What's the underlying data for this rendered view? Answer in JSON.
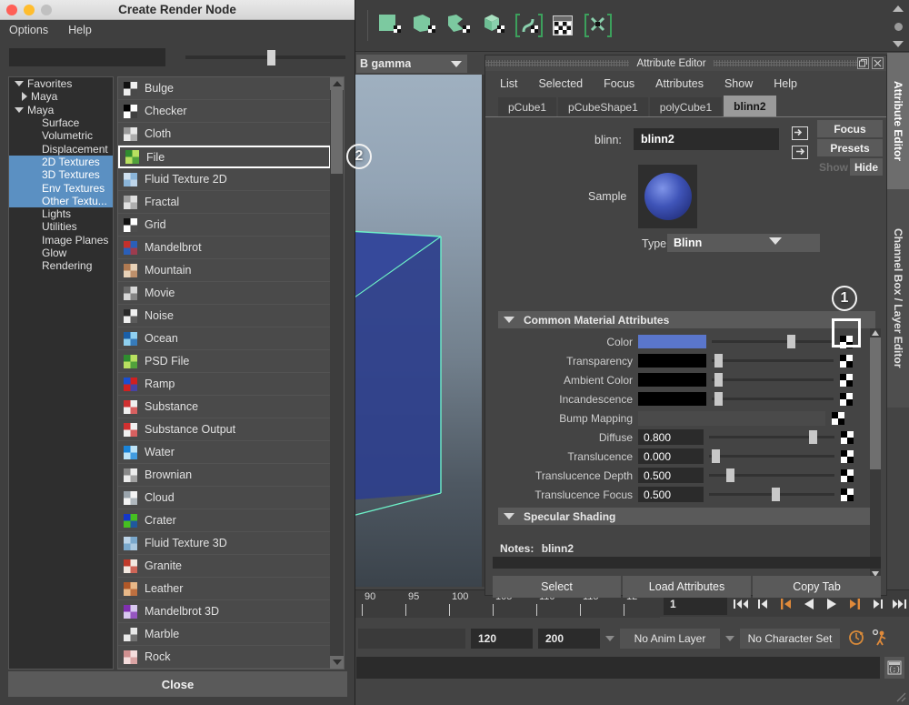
{
  "maya": {
    "toolbar": {
      "icons": [
        "poly-plane-icon",
        "poly-shape-icon",
        "poly-shape2-icon",
        "poly-cube-icon",
        "curve-bracket-icon",
        "texture-window-icon",
        "transfer-bracket-icon"
      ],
      "scroll_up_icon": "scroll-up-arrow",
      "scroll_down_icon": "scroll-down-arrow"
    },
    "viewport": {
      "renderer_label": "B gamma",
      "caret_icon": "chevron-down-icon"
    },
    "timeline": {
      "tick_labels": [
        "90",
        "95",
        "100",
        "105",
        "110",
        "115",
        "12"
      ],
      "current_frame": "1",
      "buttons": [
        {
          "name": "go-to-start-button",
          "glyph": "|◀◀"
        },
        {
          "name": "step-back-keyframe-button",
          "glyph": "|◀"
        },
        {
          "name": "step-back-frame-button",
          "glyph": "◀|"
        },
        {
          "name": "play-backwards-button",
          "glyph": "◀"
        },
        {
          "name": "play-forwards-button",
          "glyph": "▶"
        },
        {
          "name": "step-forward-frame-button",
          "glyph": "|▶"
        },
        {
          "name": "step-forward-keyframe-button",
          "glyph": "▶|"
        },
        {
          "name": "go-to-end-button",
          "glyph": "▶▶|"
        }
      ]
    },
    "range": {
      "anim_end": "120",
      "playback_end": "200",
      "anim_layer": "No Anim Layer",
      "character_set": "No Character Set",
      "auto_keyframe_icon": "auto-keyframe-icon",
      "animation_prefs_icon": "animation-preferences-icon"
    },
    "command_line": {
      "script_editor_icon": "script-editor-icon"
    },
    "side_tabs": [
      {
        "label": "Attribute Editor",
        "selected": true
      },
      {
        "label": "Channel Box / Layer Editor",
        "selected": false
      }
    ]
  },
  "attribute_editor": {
    "title": "Attribute Editor",
    "window_buttons": [
      "restore-icon",
      "close-icon"
    ],
    "menus": [
      "List",
      "Selected",
      "Focus",
      "Attributes",
      "Show",
      "Help"
    ],
    "tabs": [
      {
        "label": "pCube1",
        "active": false
      },
      {
        "label": "pCubeShape1",
        "active": false
      },
      {
        "label": "polyCube1",
        "active": false
      },
      {
        "label": "blinn2",
        "active": true
      }
    ],
    "node": {
      "type_label": "blinn:",
      "name_value": "blinn2"
    },
    "side_buttons": {
      "focus": "Focus",
      "presets": "Presets",
      "show": "Show",
      "hide": "Hide"
    },
    "sample": {
      "label": "Sample",
      "material_color": "#3f54b8"
    },
    "type": {
      "label": "Type",
      "value": "Blinn"
    },
    "sections": [
      {
        "title": "Common Material Attributes",
        "expanded": true
      },
      {
        "title": "Specular Shading",
        "expanded": true
      }
    ],
    "attributes": [
      {
        "label": "Color",
        "kind": "color",
        "color": "#5a76cc",
        "slider": 0.62,
        "map": true,
        "highlighted": true
      },
      {
        "label": "Transparency",
        "kind": "color",
        "color": "#000000",
        "slider": 0.02,
        "map": true,
        "highlighted": false
      },
      {
        "label": "Ambient Color",
        "kind": "color",
        "color": "#000000",
        "slider": 0.02,
        "map": true,
        "highlighted": false
      },
      {
        "label": "Incandescence",
        "kind": "color",
        "color": "#000000",
        "slider": 0.02,
        "map": true,
        "highlighted": false
      },
      {
        "label": "Bump Mapping",
        "kind": "bump",
        "color": "#4a4a4a",
        "slider": null,
        "map": true,
        "highlighted": false
      },
      {
        "label": "Diffuse",
        "kind": "number",
        "value": "0.800",
        "slider": 0.8,
        "map": true,
        "highlighted": false
      },
      {
        "label": "Translucence",
        "kind": "number",
        "value": "0.000",
        "slider": 0.02,
        "map": true,
        "highlighted": false
      },
      {
        "label": "Translucence Depth",
        "kind": "number",
        "value": "0.500",
        "slider": 0.14,
        "map": true,
        "highlighted": false
      },
      {
        "label": "Translucence Focus",
        "kind": "number",
        "value": "0.500",
        "slider": 0.5,
        "map": true,
        "highlighted": false
      }
    ],
    "notes": {
      "label": "Notes:",
      "value": "blinn2"
    },
    "footer_buttons": [
      "Select",
      "Load Attributes",
      "Copy Tab"
    ]
  },
  "create_render_node": {
    "window_title": "Create Render Node",
    "traffic_lights": [
      {
        "name": "close-window-button",
        "color": "#ff5f57"
      },
      {
        "name": "minimize-window-button",
        "color": "#ffbd2e"
      },
      {
        "name": "zoom-window-button",
        "color": "#c0c0c0"
      }
    ],
    "menus": [
      "Options",
      "Help"
    ],
    "search_value": "",
    "size_slider": 0.51,
    "tree": [
      {
        "label": "Favorites",
        "depth": 0,
        "arrow": "down",
        "selected": false
      },
      {
        "label": "Maya",
        "depth": 1,
        "arrow": "right",
        "selected": false
      },
      {
        "label": "Maya",
        "depth": 0,
        "arrow": "down",
        "selected": false
      },
      {
        "label": "Surface",
        "depth": 2,
        "arrow": "none",
        "selected": false
      },
      {
        "label": "Volumetric",
        "depth": 2,
        "arrow": "none",
        "selected": false
      },
      {
        "label": "Displacement",
        "depth": 2,
        "arrow": "none",
        "selected": false
      },
      {
        "label": "2D Textures",
        "depth": 2,
        "arrow": "none",
        "selected": true
      },
      {
        "label": "3D Textures",
        "depth": 2,
        "arrow": "none",
        "selected": true
      },
      {
        "label": "Env Textures",
        "depth": 2,
        "arrow": "none",
        "selected": true
      },
      {
        "label": "Other Textu...",
        "depth": 2,
        "arrow": "none",
        "selected": true
      },
      {
        "label": "Lights",
        "depth": 2,
        "arrow": "none",
        "selected": false
      },
      {
        "label": "Utilities",
        "depth": 2,
        "arrow": "none",
        "selected": false
      },
      {
        "label": "Image Planes",
        "depth": 2,
        "arrow": "none",
        "selected": false
      },
      {
        "label": "Glow",
        "depth": 2,
        "arrow": "none",
        "selected": false
      },
      {
        "label": "Rendering",
        "depth": 2,
        "arrow": "none",
        "selected": false
      }
    ],
    "nodes": [
      {
        "label": "Bulge",
        "icon": "bulge-texture-icon",
        "c1": "#111111",
        "c2": "#f0f0f0",
        "selected": false
      },
      {
        "label": "Checker",
        "icon": "checker-texture-icon",
        "c1": "#000000",
        "c2": "#ffffff",
        "selected": false
      },
      {
        "label": "Cloth",
        "icon": "cloth-texture-icon",
        "c1": "#9a9a9a",
        "c2": "#e8e8e8",
        "selected": false
      },
      {
        "label": "File",
        "icon": "file-texture-icon",
        "c1": "#2f8c2f",
        "c2": "#b8e060",
        "selected": true
      },
      {
        "label": "Fluid Texture 2D",
        "icon": "fluid-texture-2d-icon",
        "c1": "#cfe0ef",
        "c2": "#8ab4d8",
        "selected": false
      },
      {
        "label": "Fractal",
        "icon": "fractal-texture-icon",
        "c1": "#9e9e9e",
        "c2": "#e0e0e0",
        "selected": false
      },
      {
        "label": "Grid",
        "icon": "grid-texture-icon",
        "c1": "#111111",
        "c2": "#ffffff",
        "selected": false
      },
      {
        "label": "Mandelbrot",
        "icon": "mandelbrot-texture-icon",
        "c1": "#c4302b",
        "c2": "#2a5fb8",
        "selected": false
      },
      {
        "label": "Mountain",
        "icon": "mountain-texture-icon",
        "c1": "#b07a52",
        "c2": "#e8d2b8",
        "selected": false
      },
      {
        "label": "Movie",
        "icon": "movie-texture-icon",
        "c1": "#6a6a6a",
        "c2": "#d8d8d8",
        "selected": false
      },
      {
        "label": "Noise",
        "icon": "noise-texture-icon",
        "c1": "#2a2a2a",
        "c2": "#f0f0f0",
        "selected": false
      },
      {
        "label": "Ocean",
        "icon": "ocean-texture-icon",
        "c1": "#1a5fa8",
        "c2": "#8fd0f0",
        "selected": false
      },
      {
        "label": "PSD File",
        "icon": "psd-file-texture-icon",
        "c1": "#2f8c2f",
        "c2": "#b8e060",
        "selected": false
      },
      {
        "label": "Ramp",
        "icon": "ramp-texture-icon",
        "c1": "#1a4fd0",
        "c2": "#d02020",
        "selected": false
      },
      {
        "label": "Substance",
        "icon": "substance-texture-icon",
        "c1": "#d03030",
        "c2": "#f0f0f0",
        "selected": false
      },
      {
        "label": "Substance Output",
        "icon": "substance-output-icon",
        "c1": "#d03030",
        "c2": "#f0f0f0",
        "selected": false
      },
      {
        "label": "Water",
        "icon": "water-texture-icon",
        "c1": "#1a84d8",
        "c2": "#bde4f8",
        "selected": false
      },
      {
        "label": "Brownian",
        "icon": "brownian-texture-icon",
        "c1": "#8a8a8a",
        "c2": "#ececec",
        "selected": false
      },
      {
        "label": "Cloud",
        "icon": "cloud-texture-icon",
        "c1": "#9aa4ac",
        "c2": "#f4f4f4",
        "selected": false
      },
      {
        "label": "Crater",
        "icon": "crater-texture-icon",
        "c1": "#1436c8",
        "c2": "#46c020",
        "selected": false
      },
      {
        "label": "Fluid Texture 3D",
        "icon": "fluid-texture-3d-icon",
        "c1": "#bcd4e8",
        "c2": "#7aa8cc",
        "selected": false
      },
      {
        "label": "Granite",
        "icon": "granite-texture-icon",
        "c1": "#c03a2a",
        "c2": "#f2e8e0",
        "selected": false
      },
      {
        "label": "Leather",
        "icon": "leather-texture-icon",
        "c1": "#b05828",
        "c2": "#e8b888",
        "selected": false
      },
      {
        "label": "Mandelbrot 3D",
        "icon": "mandelbrot-3d-icon",
        "c1": "#8030b0",
        "c2": "#d8c8f0",
        "selected": false
      },
      {
        "label": "Marble",
        "icon": "marble-texture-icon",
        "c1": "#4a4a4a",
        "c2": "#e8e8e8",
        "selected": false
      },
      {
        "label": "Rock",
        "icon": "rock-texture-icon",
        "c1": "#d09090",
        "c2": "#f4dcdc",
        "selected": false
      }
    ],
    "close_button": "Close"
  },
  "annotations": [
    {
      "number": "1",
      "target": "color-map-button"
    },
    {
      "number": "2",
      "target": "file-node-list-item"
    }
  ]
}
